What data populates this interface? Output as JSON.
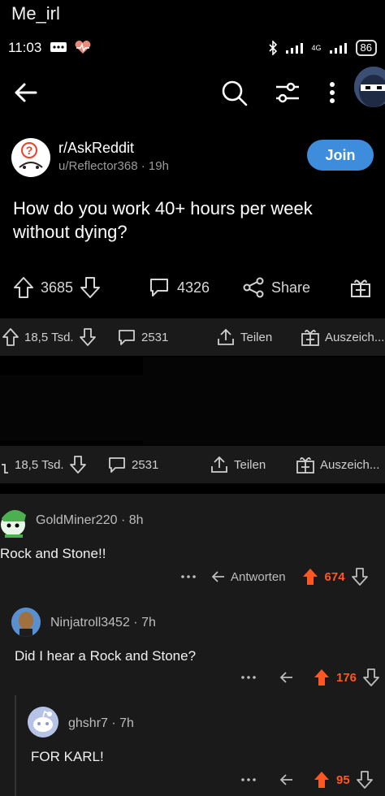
{
  "meme": {
    "caption": "Me_irl"
  },
  "statusbar": {
    "time": "11:03",
    "battery": "86",
    "network": "4G"
  },
  "topbar": {
    "icons": [
      "back-arrow-icon",
      "search-icon",
      "filter-icon",
      "more-vertical-icon",
      "profile-avatar"
    ]
  },
  "post": {
    "subreddit": "r/AskReddit",
    "author": "u/Reflector368",
    "age": "19h",
    "join_label": "Join",
    "title": "How do you work 40+ hours per week without dying?",
    "upvotes": "3685",
    "comments": "4326",
    "share_label": "Share"
  },
  "german_bars": [
    {
      "votes": "18,5 Tsd.",
      "comments": "2531",
      "share": "Teilen",
      "award": "Auszeich..."
    },
    {
      "votes": "18,5 Tsd.",
      "comments": "2531",
      "share": "Teilen",
      "award": "Auszeich..."
    }
  ],
  "comments": [
    {
      "user": "GoldMiner220",
      "age": "8h",
      "body": "Rock and Stone!!",
      "reply": "Antworten",
      "votes": "674"
    },
    {
      "user": "Ninjatroll3452",
      "age": "7h",
      "body": "Did I hear a Rock and Stone?",
      "votes": "176"
    },
    {
      "user": "ghshr7",
      "age": "7h",
      "body": "FOR KARL!",
      "votes": "95"
    }
  ],
  "colors": {
    "accent_blue": "#3e8ddd",
    "upvote_orange": "#ff5722",
    "panel": "#1a1a1b"
  }
}
